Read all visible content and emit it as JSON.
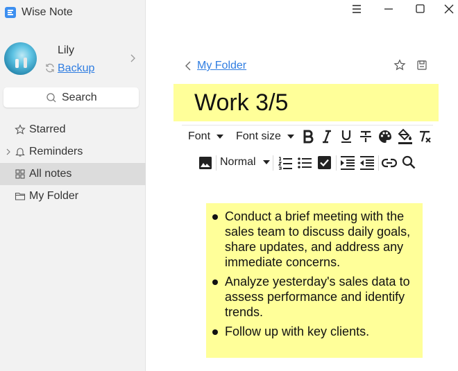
{
  "app": {
    "title": "Wise Note"
  },
  "user": {
    "name": "Lily",
    "backup_label": "Backup"
  },
  "sidebar": {
    "search_label": "Search",
    "items": [
      {
        "label": "Starred",
        "icon": "star-icon"
      },
      {
        "label": "Reminders",
        "icon": "bell-icon"
      },
      {
        "label": "All notes",
        "icon": "grid-icon",
        "active": true
      },
      {
        "label": "My Folder",
        "icon": "folder-icon"
      }
    ]
  },
  "header": {
    "breadcrumb": "My Folder"
  },
  "note": {
    "title": "Work 3/5",
    "bullets": [
      "Conduct a brief meeting with the sales team to discuss daily goals, share updates, and address any immediate concerns.",
      "Analyze yesterday's sales data to assess performance and identify trends.",
      "Follow up with key clients."
    ]
  },
  "toolbar": {
    "font_label": "Font",
    "font_size_label": "Font size",
    "paragraph_style": "Normal"
  },
  "colors": {
    "accent": "#2f7de1",
    "highlight": "#ffff99",
    "sidebar_bg": "#f2f2f2",
    "active_item_bg": "#dcdcdc"
  }
}
